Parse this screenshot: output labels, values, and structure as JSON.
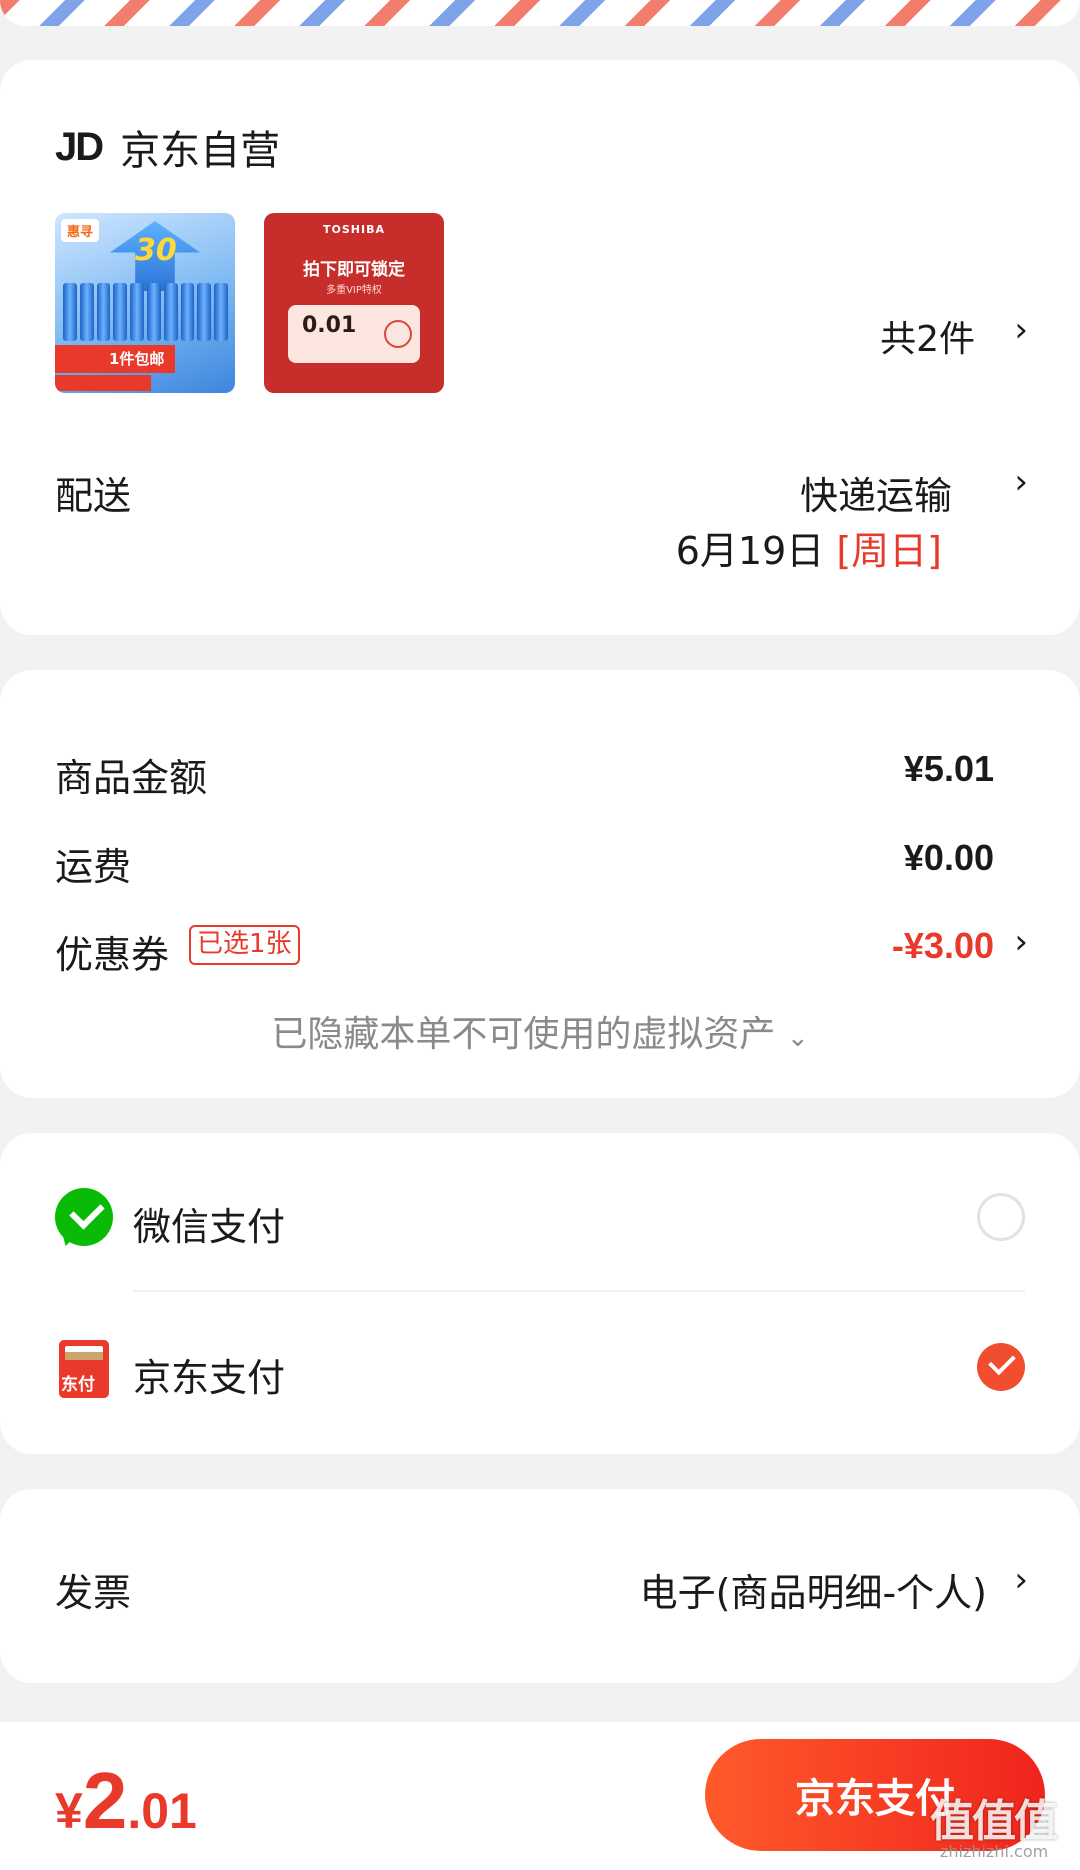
{
  "shop": {
    "logo_text": "JD",
    "name": "京东自营"
  },
  "products": {
    "thumb1": {
      "badge": "惠寻",
      "big_text": "30",
      "tag": "1件包邮"
    },
    "thumb2": {
      "brand": "TOSHIBA",
      "title": "拍下即可锁定",
      "subtitle": "多重VIP特权",
      "price": "0.01"
    },
    "count_label": "共2件"
  },
  "delivery": {
    "label": "配送",
    "method": "快递运输",
    "date": "6月19日",
    "weekday": "[周日]"
  },
  "amounts": {
    "goods_label": "商品金额",
    "goods_value": "¥5.01",
    "shipping_label": "运费",
    "shipping_value": "¥0.00",
    "coupon_label": "优惠券",
    "coupon_tag": "已选1张",
    "coupon_value": "-¥3.00",
    "hidden_note": "已隐藏本单不可使用的虚拟资产"
  },
  "payment": {
    "wechat_label": "微信支付",
    "jdpay_label": "京东支付",
    "jdpay_icon_text": "东付",
    "selected": "京东支付"
  },
  "invoice": {
    "label": "发票",
    "value": "电子(商品明细-个人)"
  },
  "footer": {
    "total_currency": "¥",
    "total_int": "2",
    "total_dec": ".01",
    "pay_button": "京东支付"
  },
  "watermark": {
    "main": "值值值",
    "sub": "zhizhizhi.com"
  },
  "colors": {
    "accent": "#e8392b",
    "wechat": "#09bb07",
    "background": "#f2f2f2"
  },
  "icons": {
    "chevron": "chevron-right-icon",
    "collapse": "chevron-down-icon",
    "radio_on": "check-circle-icon"
  }
}
